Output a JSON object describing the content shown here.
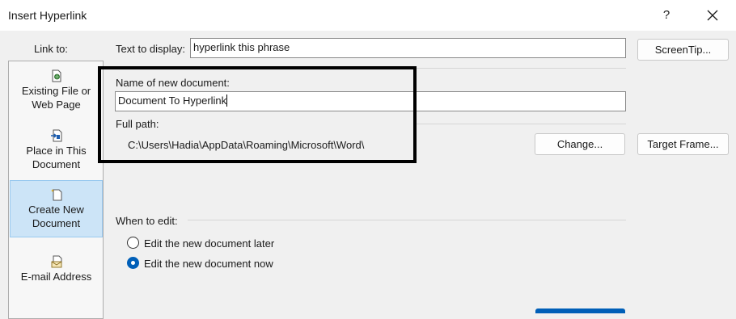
{
  "window": {
    "title": "Insert Hyperlink",
    "help_glyph": "?"
  },
  "link_to": {
    "label": "Link to:",
    "items": [
      {
        "line1": "Existing File or",
        "line2": "Web Page",
        "icon": "existing-file-icon"
      },
      {
        "line1": "Place in This",
        "line2": "Document",
        "icon": "place-in-document-icon"
      },
      {
        "line1": "Create New",
        "line2": "Document",
        "icon": "create-new-document-icon",
        "selected": true
      },
      {
        "line1": "E-mail Address",
        "line2": "",
        "icon": "email-address-icon"
      }
    ]
  },
  "text_to_display": {
    "label": "Text to display:",
    "value": "hyperlink this phrase"
  },
  "buttons": {
    "screentip": "ScreenTip...",
    "change": "Change...",
    "target_frame": "Target Frame..."
  },
  "new_document": {
    "name_label": "Name of new document:",
    "name_value": "Document To Hyperlink",
    "full_path_label": "Full path:",
    "full_path_value": "C:\\Users\\Hadia\\AppData\\Roaming\\Microsoft\\Word\\"
  },
  "when_to_edit": {
    "label": "When to edit:",
    "options": [
      {
        "label": "Edit the new document later",
        "selected": false
      },
      {
        "label": "Edit the new document now",
        "selected": true
      }
    ]
  },
  "colors": {
    "accent": "#005fb8",
    "selected_bg": "#cce4f7",
    "dialog_bg": "#f0f0f0"
  }
}
